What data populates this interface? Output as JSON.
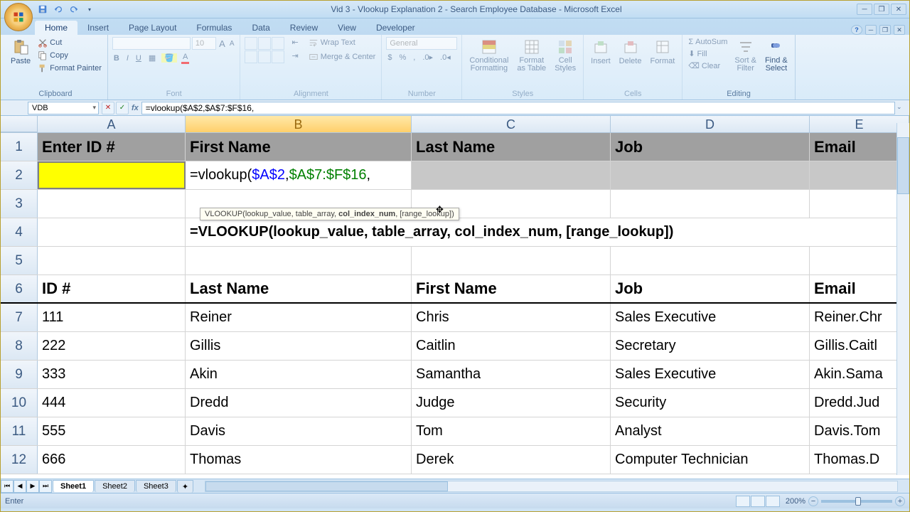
{
  "title": "Vid 3 - Vlookup Explanation 2 - Search Employee Database - Microsoft Excel",
  "tabs": [
    "Home",
    "Insert",
    "Page Layout",
    "Formulas",
    "Data",
    "Review",
    "View",
    "Developer"
  ],
  "activeTab": "Home",
  "ribbon": {
    "clipboard": {
      "label": "Clipboard",
      "paste": "Paste",
      "cut": "Cut",
      "copy": "Copy",
      "fp": "Format Painter"
    },
    "font": {
      "label": "Font",
      "family": "",
      "size": "10"
    },
    "alignment": {
      "label": "Alignment",
      "wrap": "Wrap Text",
      "merge": "Merge & Center"
    },
    "number": {
      "label": "Number",
      "fmt": "General"
    },
    "styles": {
      "label": "Styles",
      "cf": "Conditional\nFormatting",
      "fat": "Format\nas Table",
      "cs": "Cell\nStyles"
    },
    "cells": {
      "label": "Cells",
      "ins": "Insert",
      "del": "Delete",
      "fmt": "Format"
    },
    "editing": {
      "label": "Editing",
      "sum": "AutoSum",
      "fill": "Fill",
      "clear": "Clear",
      "sort": "Sort &\nFilter",
      "find": "Find &\nSelect"
    }
  },
  "namebox": "VDB",
  "formula": "=vlookup($A$2,$A$7:$F$16,",
  "formulaParts": {
    "p1": "=vlookup(",
    "p2": "$A$2",
    "c1": ",",
    "p3": "$A$7:$F$16",
    "c2": ","
  },
  "tooltip": {
    "pre": "VLOOKUP(lookup_value, table_array, ",
    "bold": "col_index_num",
    "post": ", [range_lookup])"
  },
  "cols": [
    "A",
    "B",
    "C",
    "D",
    "E"
  ],
  "activeCol": "B",
  "headers": {
    "A": "Enter ID #",
    "B": "First Name",
    "C": "Last Name",
    "D": "Job",
    "E": "Email"
  },
  "row4": "=VLOOKUP(lookup_value, table_array, col_index_num, [range_lookup])",
  "row6": {
    "A": "ID #",
    "B": "Last Name",
    "C": "First Name",
    "D": "Job",
    "E": "Email"
  },
  "dataRows": [
    {
      "n": "7",
      "A": "111",
      "B": "Reiner",
      "C": "Chris",
      "D": "Sales Executive",
      "E": "Reiner.Chr"
    },
    {
      "n": "8",
      "A": "222",
      "B": "Gillis",
      "C": "Caitlin",
      "D": "Secretary",
      "E": "Gillis.Caitl"
    },
    {
      "n": "9",
      "A": "333",
      "B": "Akin",
      "C": "Samantha",
      "D": "Sales Executive",
      "E": "Akin.Sama"
    },
    {
      "n": "10",
      "A": "444",
      "B": "Dredd",
      "C": "Judge",
      "D": "Security",
      "E": "Dredd.Jud"
    },
    {
      "n": "11",
      "A": "555",
      "B": "Davis",
      "C": "Tom",
      "D": "Analyst",
      "E": "Davis.Tom"
    },
    {
      "n": "12",
      "A": "666",
      "B": "Thomas",
      "C": "Derek",
      "D": "Computer Technician",
      "E": "Thomas.D"
    }
  ],
  "sheets": [
    "Sheet1",
    "Sheet2",
    "Sheet3"
  ],
  "activeSheet": "Sheet1",
  "status": "Enter",
  "zoom": "200%"
}
